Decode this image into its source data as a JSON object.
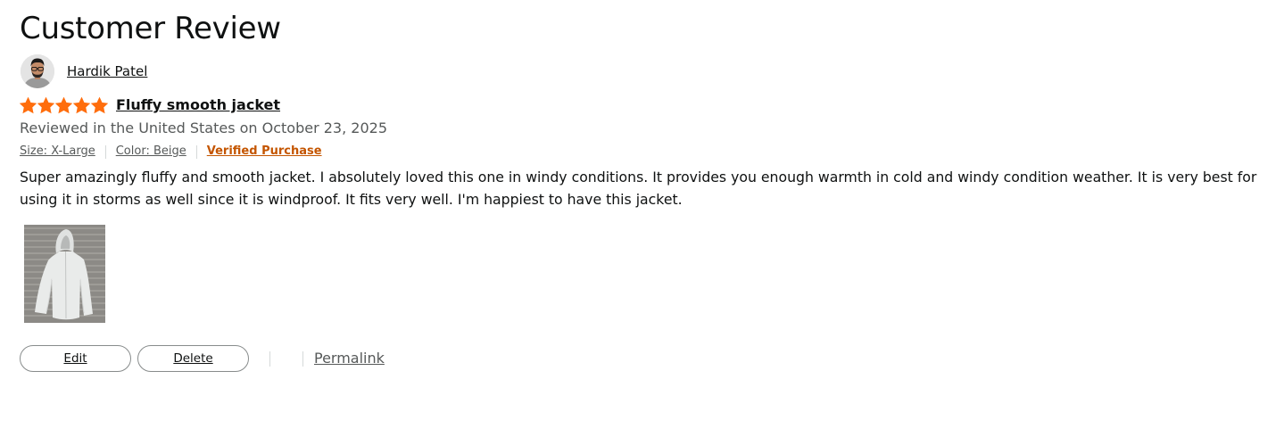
{
  "page": {
    "title": "Customer Review"
  },
  "reviewer": {
    "name": "Hardik Patel",
    "avatar_icon": "person-photo-icon"
  },
  "rating": {
    "value": 5,
    "max": 5,
    "color": "#ff6d0c"
  },
  "review": {
    "title": "Fluffy smooth jacket",
    "date_line": "Reviewed in the United States on October 23, 2025",
    "size": "Size: X-Large",
    "color_option": "Color: Beige",
    "verified": "Verified Purchase",
    "verified_color": "#c45500",
    "body": "Super amazingly fluffy and smooth jacket. I absolutely loved this one in windy conditions. It provides you enough warmth in cold and windy condition weather. It is very best for using it in storms as well since it is windproof. It fits very well. I'm happiest to have this jacket.",
    "image_icon": "jacket-photo-icon"
  },
  "actions": {
    "edit_label": "Edit",
    "delete_label": "Delete",
    "permalink_label": "Permalink"
  }
}
